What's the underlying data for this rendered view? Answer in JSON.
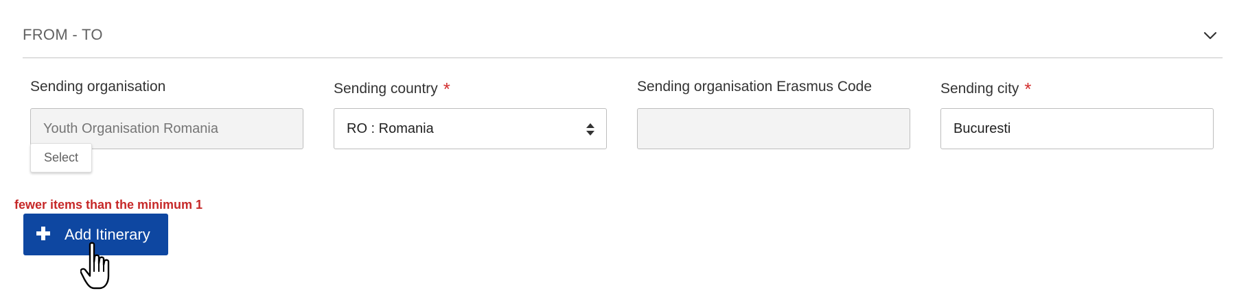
{
  "section": {
    "title": "FROM - TO"
  },
  "fields": {
    "sending_organisation": {
      "label": "Sending organisation",
      "value": "Youth Organisation Romania"
    },
    "sending_country": {
      "label": "Sending country",
      "required_mark": "*",
      "value": "RO : Romania"
    },
    "erasmus_code": {
      "label": "Sending organisation Erasmus Code",
      "value": ""
    },
    "sending_city": {
      "label": "Sending city",
      "required_mark": "*",
      "value": "Bucuresti"
    }
  },
  "select_button": {
    "label": "Select"
  },
  "error": {
    "message": "fewer items than the minimum 1"
  },
  "add_itinerary": {
    "label": "Add Itinerary"
  },
  "colors": {
    "primary": "#0e47a1",
    "error": "#c62828",
    "required": "#d32f2f"
  },
  "icons": [
    "chevron-down-icon",
    "select-arrows-icon",
    "plus-icon",
    "hand-cursor-icon"
  ]
}
